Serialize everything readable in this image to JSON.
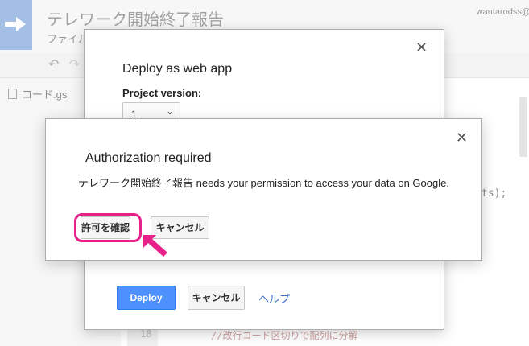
{
  "app": {
    "title": "テレワーク開始終了報告",
    "menu": "ファイル",
    "user": "wantarodss@"
  },
  "file_pane": {
    "file_name": "コード.gs"
  },
  "editor": {
    "line_number": "18",
    "code_line": "//改行コード区切りで配列に分解",
    "code_fragment": "ts);"
  },
  "deploy_dialog": {
    "title": "Deploy as web app",
    "project_version_label": "Project version:",
    "project_version_value": "1",
    "deploy_button": "Deploy",
    "cancel_button": "キャンセル",
    "help_link": "ヘルプ"
  },
  "auth_dialog": {
    "title": "Authorization required",
    "message": "テレワーク開始終了報告 needs your permission to access your data on Google.",
    "review_button": "許可を確認",
    "cancel_button": "キャンセル"
  },
  "icons": {
    "close": "close-icon",
    "highlight_color": "#e8208a",
    "primary_color": "#4d90fe"
  }
}
